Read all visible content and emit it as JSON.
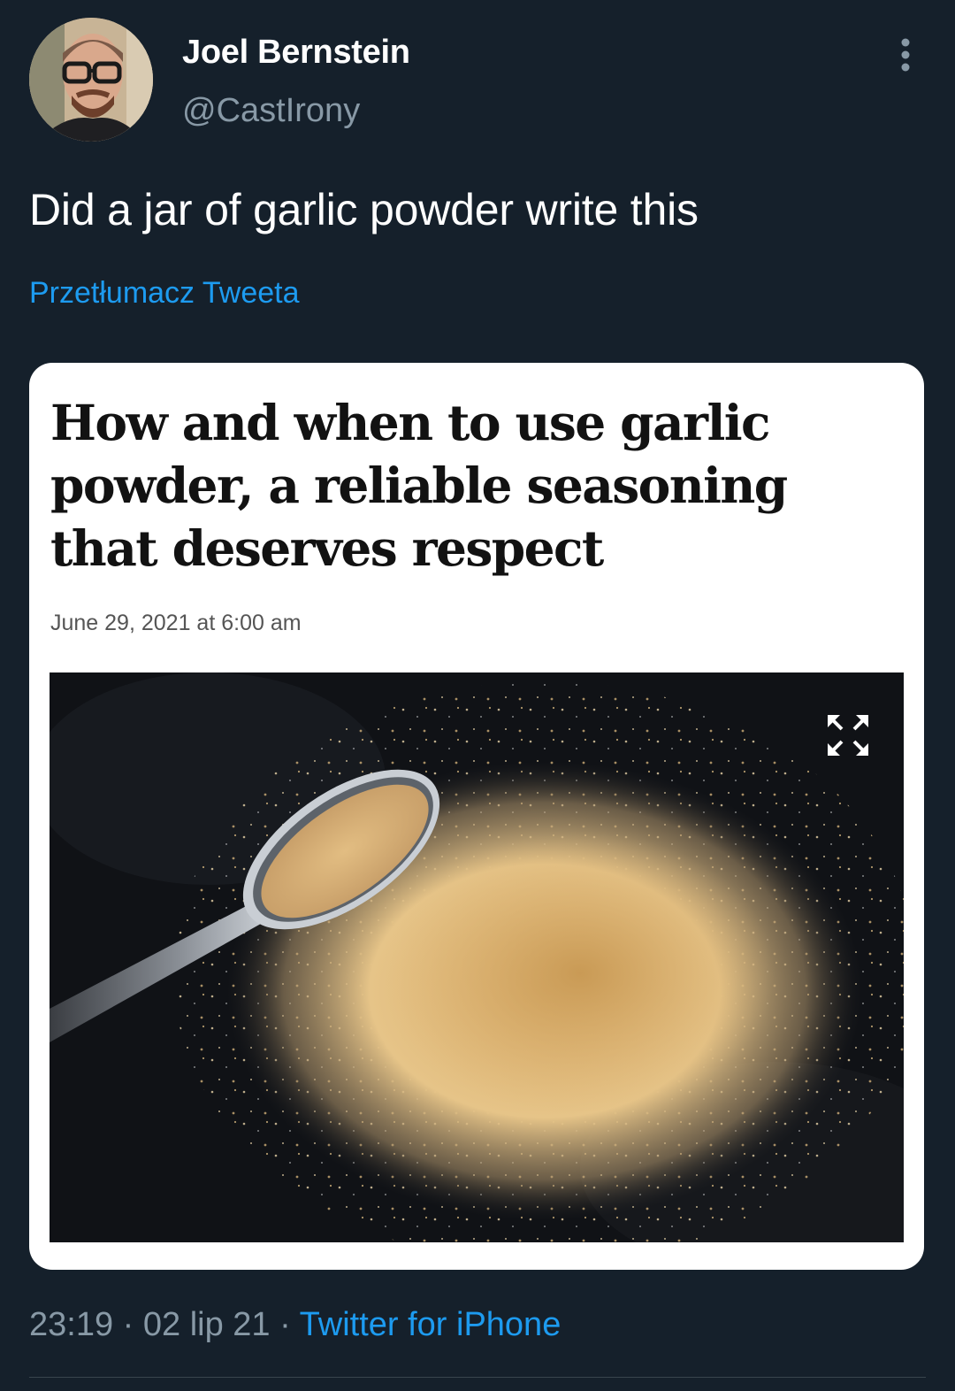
{
  "tweet": {
    "author_name": "Joel Bernstein",
    "author_handle": "@CastIrony",
    "text": "Did a jar of garlic powder write this",
    "translate_label": "Przetłumacz Tweeta",
    "time": "23:19",
    "date": "02 lip 21",
    "separator": "·",
    "source": "Twitter for iPhone"
  },
  "article": {
    "headline": "How and when to use garlic\npowder, a reliable seasoning\nthat deserves respect",
    "date": "June 29, 2021 at 6:00 am"
  },
  "icons": {
    "more": "more-vertical-icon",
    "expand": "expand-icon"
  },
  "colors": {
    "background": "#15202b",
    "link": "#1d9bf0",
    "secondary_text": "#8899a6",
    "card": "#ffffff"
  }
}
